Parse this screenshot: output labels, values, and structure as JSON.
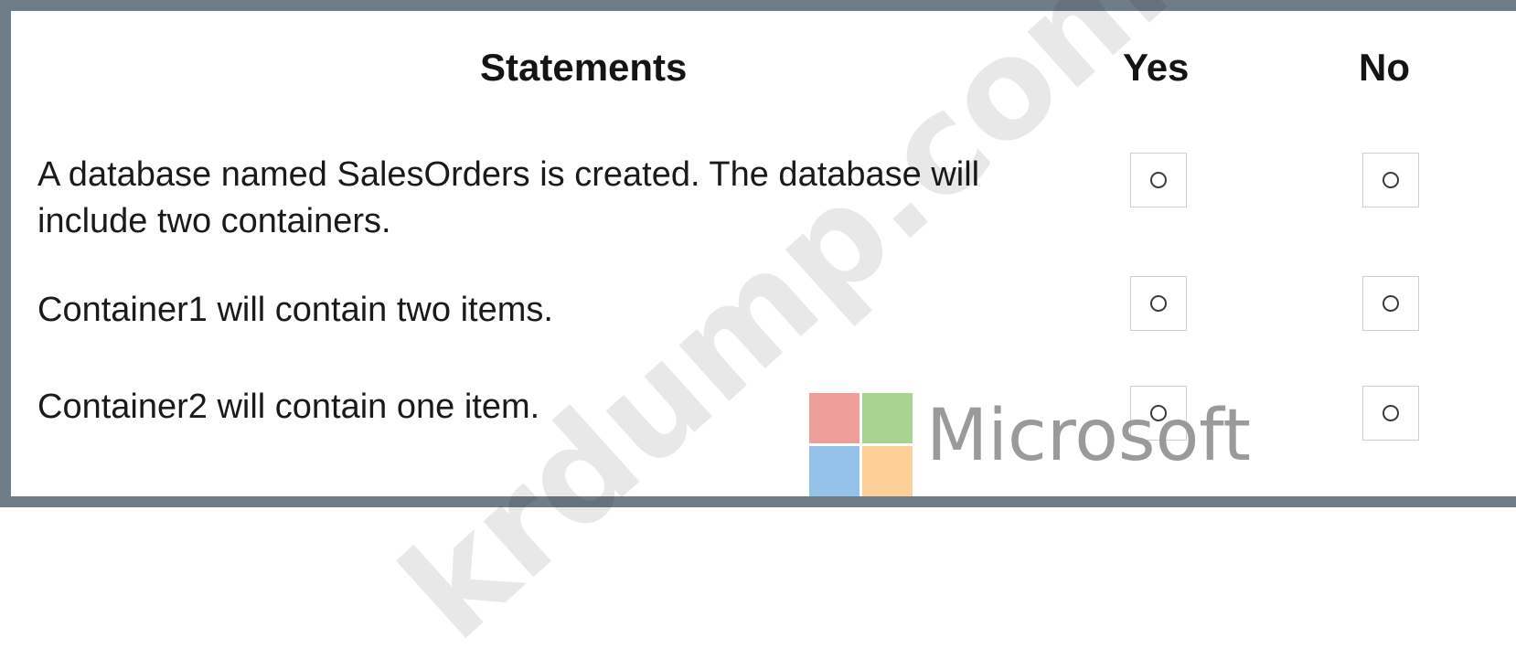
{
  "table": {
    "headers": {
      "statements": "Statements",
      "yes": "Yes",
      "no": "No"
    },
    "rows": [
      {
        "line1": "A database named SalesOrders is created. The database will",
        "line2": "include two containers.",
        "yes_selected": false,
        "no_selected": false
      },
      {
        "line1": "Container1 will contain two items.",
        "yes_selected": false,
        "no_selected": false
      },
      {
        "line1": "Container2 will contain one item.",
        "yes_selected": false,
        "no_selected": false
      }
    ]
  },
  "overlay": {
    "watermark_text": "krdump.com",
    "logo_text": "Microsoft",
    "logo_colors": [
      "#ee9f9a",
      "#a9d390",
      "#95c2e8",
      "#fcd096"
    ]
  },
  "colors": {
    "border": "#6f7d89",
    "background": "#ffffff"
  }
}
